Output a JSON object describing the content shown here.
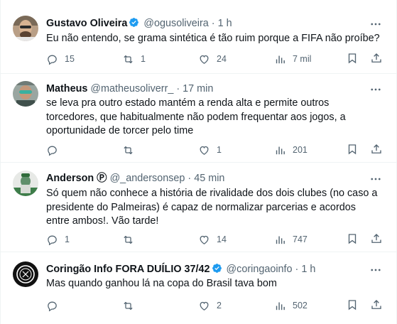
{
  "tweets": [
    {
      "name": "Gustavo Oliveira",
      "verified": true,
      "handle": "@ogusoliveira",
      "separator": "·",
      "time": "1 h",
      "text": "Eu não entendo, se grama sintética é tão ruim porque a FIFA não proíbe?",
      "replies": "15",
      "retweets": "1",
      "likes": "24",
      "views": "7 mil",
      "avatar": "avatar-photo"
    },
    {
      "name": "Matheus",
      "verified": false,
      "handle": "@matheusoliverr_",
      "separator": "·",
      "time": "17 min",
      "text": "se leva pra outro estado mantém a renda alta e permite outros torcedores, que habitualmente não podem frequentar aos jogos, a oportunidade de torcer pelo time",
      "replies": "",
      "retweets": "",
      "likes": "1",
      "views": "201",
      "avatar": "avatar-photo"
    },
    {
      "name": "Anderson",
      "name_badge": "Ⓟ",
      "verified": false,
      "handle": "@_andersonsep",
      "separator": "·",
      "time": "45 min",
      "text": "Só quem não conhece a história de rivalidade dos dois clubes (no caso a presidente do Palmeiras) é capaz de normalizar parcerias e acordos entre ambos!. Vão tarde!",
      "replies": "1",
      "retweets": "",
      "likes": "14",
      "views": "747",
      "avatar": "avatar-photo"
    },
    {
      "name": "Coringão Info FORA DUÍLIO 37/42",
      "verified": true,
      "handle": "@coringaoinfo",
      "separator": "·",
      "time": "1 h",
      "text": "Mas quando ganhou lá na copa do Brasil tava bom",
      "replies": "",
      "retweets": "",
      "likes": "2",
      "views": "502",
      "avatar": "avatar-logo"
    }
  ],
  "icons": {
    "reply": "reply-icon",
    "retweet": "retweet-icon",
    "like": "heart-icon",
    "views": "views-icon",
    "bookmark": "bookmark-icon",
    "share": "share-icon",
    "more": "more-icon",
    "verified": "verified-badge-icon"
  },
  "colors": {
    "text": "#0f1419",
    "secondary": "#536471",
    "verified": "#1d9bf0",
    "divider": "#eff3f4"
  }
}
